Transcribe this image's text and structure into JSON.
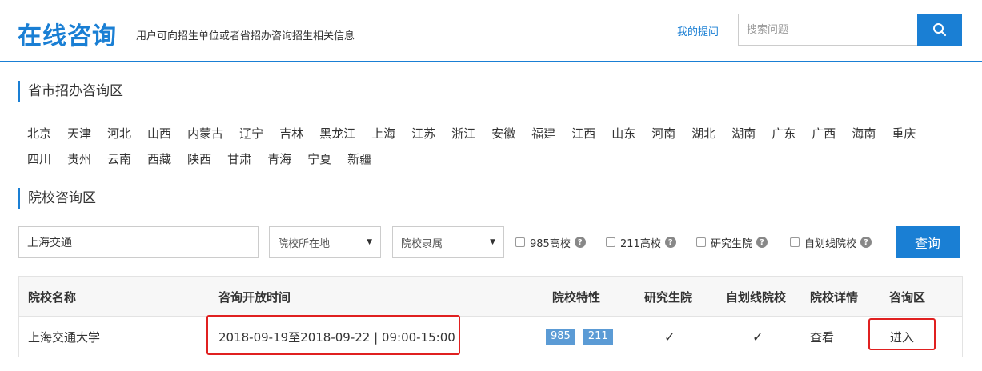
{
  "header": {
    "brand": "在线咨询",
    "subtitle": "用户可向招生单位或者省招办咨询招生相关信息",
    "my_questions": "我的提问",
    "search_placeholder": "搜索问题"
  },
  "provinces_section": {
    "title": "省市招办咨询区",
    "row1": [
      "北京",
      "天津",
      "河北",
      "山西",
      "内蒙古",
      "辽宁",
      "吉林",
      "黑龙江",
      "上海",
      "江苏",
      "浙江",
      "安徽",
      "福建",
      "江西",
      "山东",
      "河南",
      "湖北",
      "湖南",
      "广东",
      "广西",
      "海南",
      "重庆"
    ],
    "row2": [
      "四川",
      "贵州",
      "云南",
      "西藏",
      "陕西",
      "甘肃",
      "青海",
      "宁夏",
      "新疆"
    ]
  },
  "schools_section": {
    "title": "院校咨询区",
    "school_input_value": "上海交通",
    "location_select": "院校所在地",
    "affiliation_select": "院校隶属",
    "checkboxes": [
      "985高校",
      "211高校",
      "研究生院",
      "自划线院校"
    ],
    "help_glyph": "?",
    "query_button": "查询"
  },
  "table": {
    "headers": [
      "院校名称",
      "咨询开放时间",
      "院校特性",
      "研究生院",
      "自划线院校",
      "院校详情",
      "咨询区"
    ],
    "rows": [
      {
        "name": "上海交通大学",
        "open_time": "2018-09-19至2018-09-22 | 09:00-15:00",
        "tags": [
          "985",
          "211"
        ],
        "grad_school": "✓",
        "self_line": "✓",
        "details": "查看",
        "enter": "进入"
      }
    ]
  },
  "colors": {
    "accent": "#1a7fd4",
    "tag": "#5b9bd5",
    "highlight": "#e02020"
  }
}
